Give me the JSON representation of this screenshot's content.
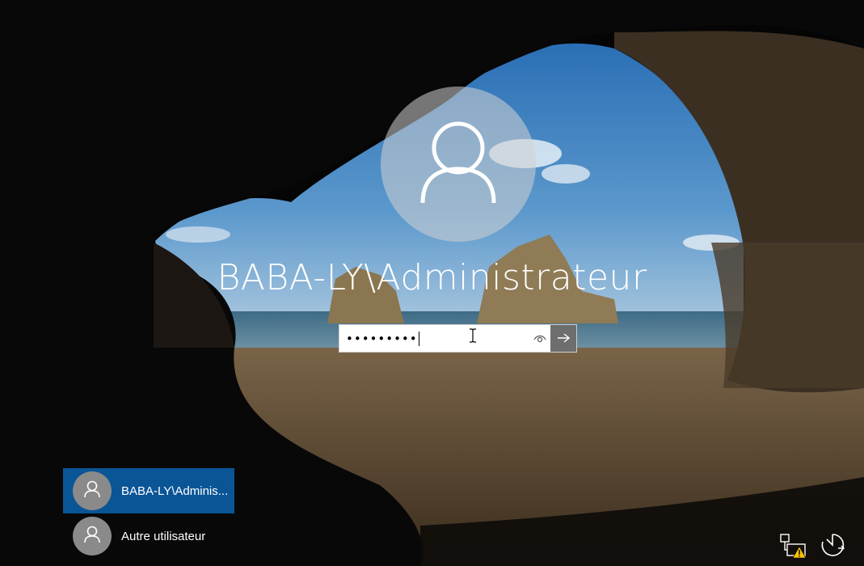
{
  "login": {
    "username_display": "BABA-LY\\Administrateur",
    "password_masked": "•••••••••",
    "icons": {
      "avatar": "user-silhouette-icon",
      "reveal": "eye-icon",
      "submit": "arrow-right-icon"
    }
  },
  "user_list": [
    {
      "label": "BABA-LY\\Adminis...",
      "selected": true
    },
    {
      "label": "Autre utilisateur",
      "selected": false
    }
  ],
  "tray": {
    "network_icon": "network-warning-icon",
    "power_icon": "ease-of-access-power-icon"
  },
  "colors": {
    "selected_user_bg": "#0a5596",
    "submit_bg": "#6e6e6e",
    "warning": "#f5c400"
  }
}
